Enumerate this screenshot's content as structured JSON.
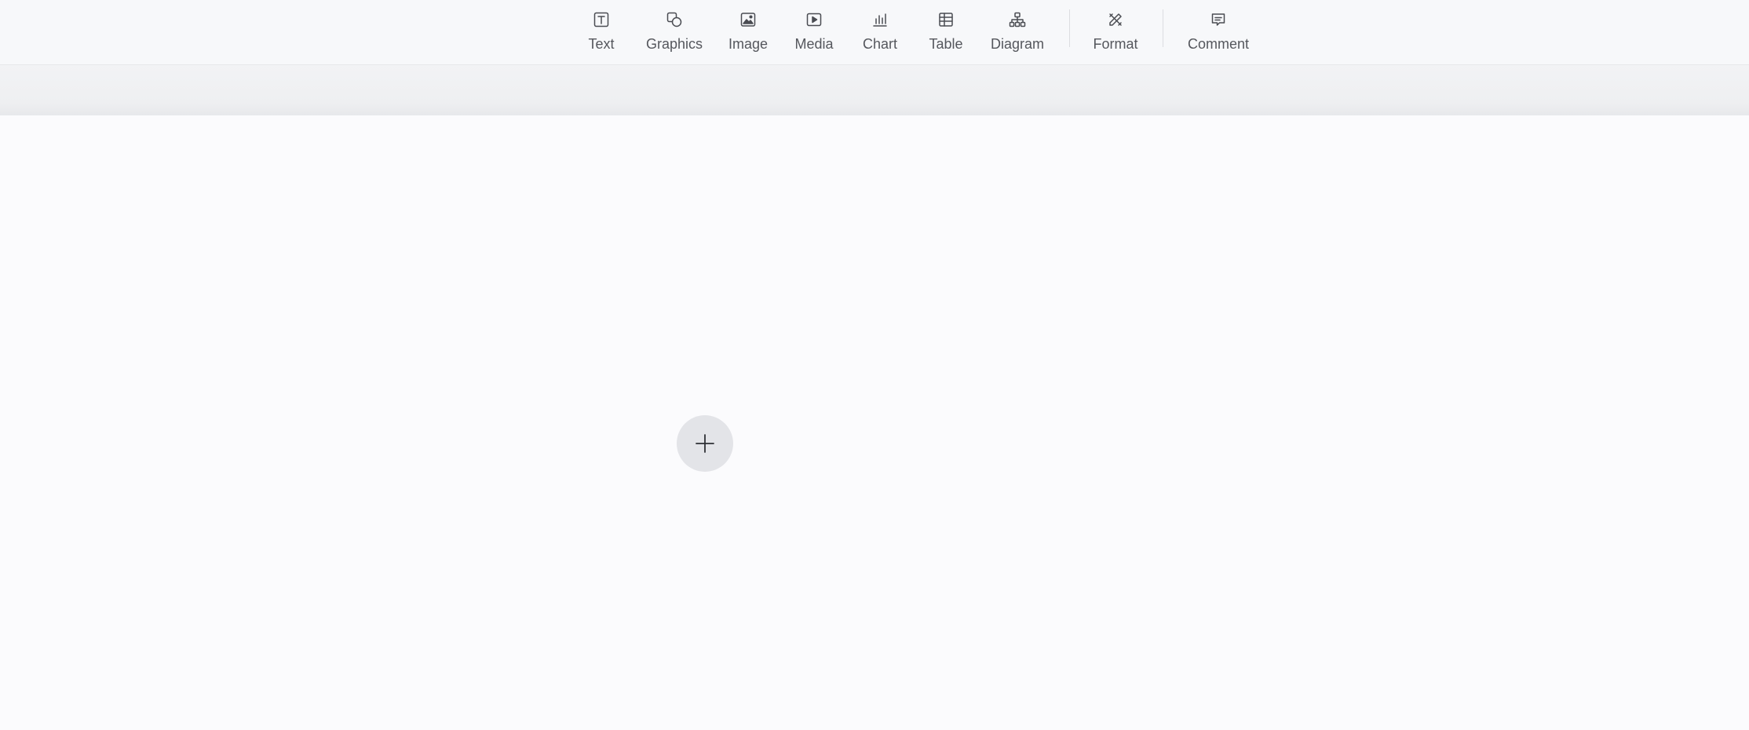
{
  "toolbar": {
    "items": [
      {
        "id": "text",
        "label": "Text",
        "icon": "text-box-icon"
      },
      {
        "id": "graphics",
        "label": "Graphics",
        "icon": "shapes-icon"
      },
      {
        "id": "image",
        "label": "Image",
        "icon": "image-icon"
      },
      {
        "id": "media",
        "label": "Media",
        "icon": "play-icon"
      },
      {
        "id": "chart",
        "label": "Chart",
        "icon": "bar-chart-icon"
      },
      {
        "id": "table",
        "label": "Table",
        "icon": "table-icon"
      },
      {
        "id": "diagram",
        "label": "Diagram",
        "icon": "hierarchy-icon"
      },
      {
        "id": "format",
        "label": "Format",
        "icon": "ruler-pencil-icon"
      },
      {
        "id": "comment",
        "label": "Comment",
        "icon": "comment-icon"
      }
    ]
  },
  "canvas": {
    "add_button_icon": "plus-icon"
  },
  "colors": {
    "toolbar_bg": "#f7f8fa",
    "canvas_bg": "#fbfbfd",
    "icon_stroke": "#4a4c52",
    "add_button_bg": "#e3e4e8"
  }
}
